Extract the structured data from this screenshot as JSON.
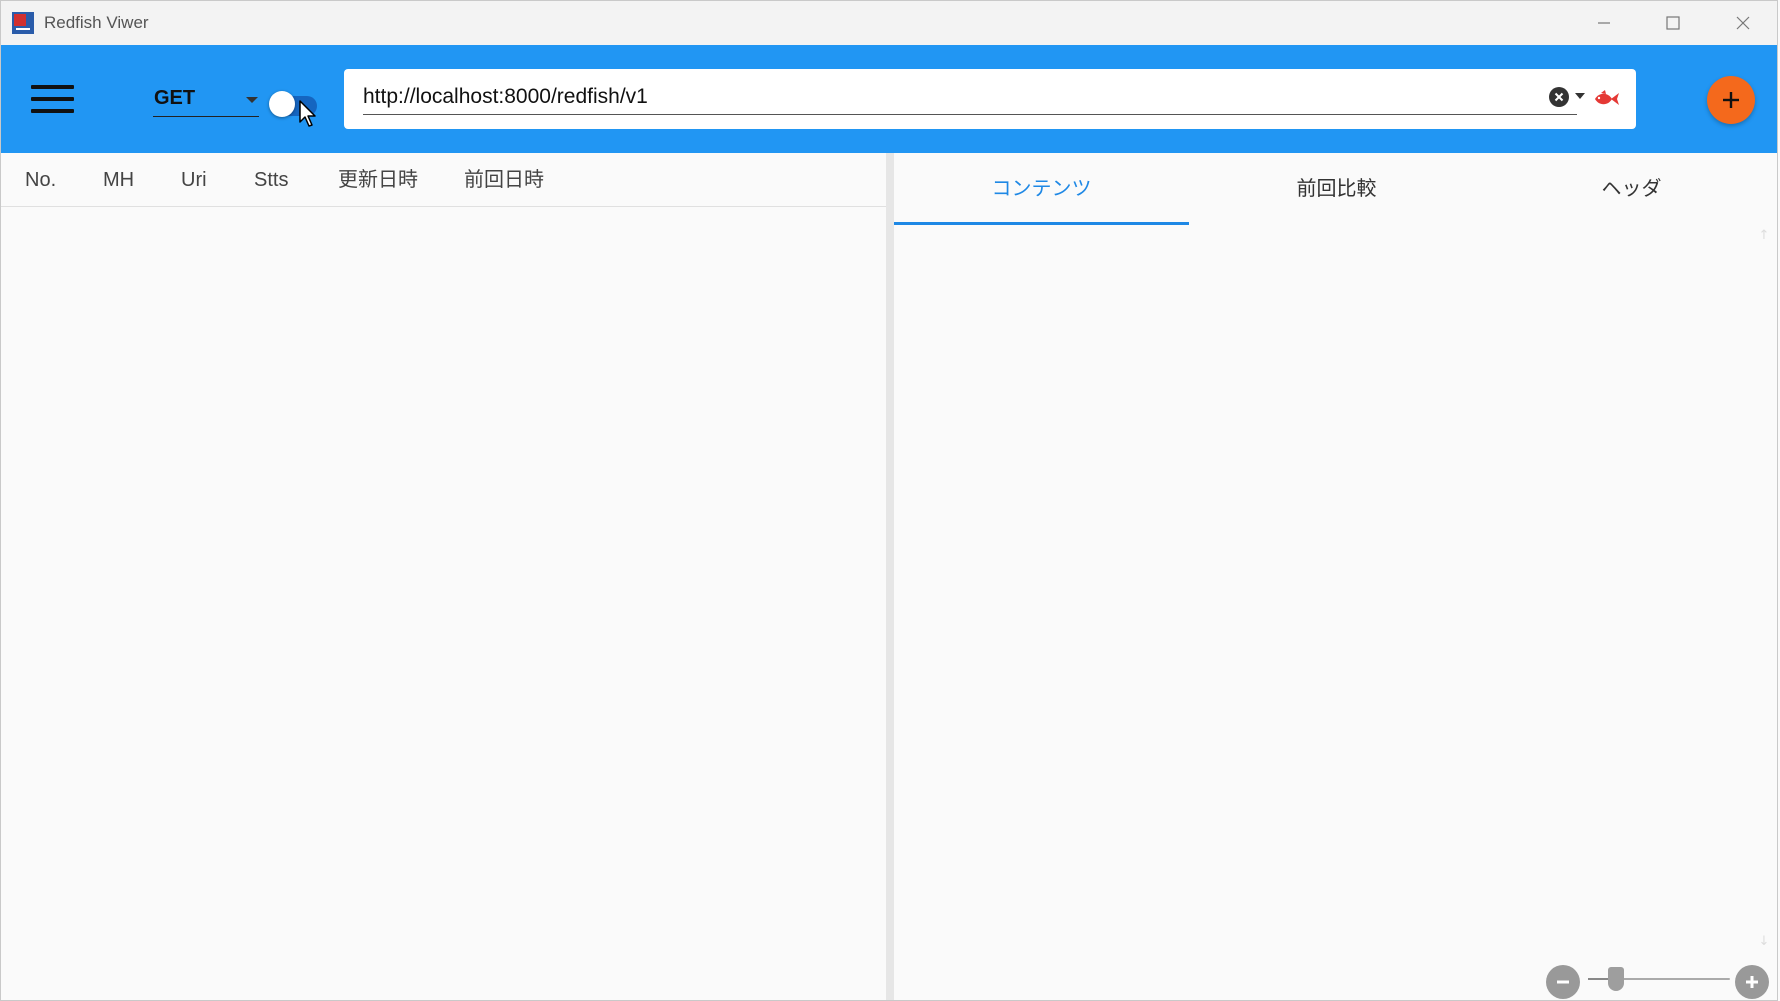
{
  "window": {
    "title": "Redfish Viwer"
  },
  "toolbar": {
    "method": "GET",
    "method_options_visible": [
      "GET"
    ],
    "toggle_on": true,
    "url": "http://localhost:8000/redfish/v1",
    "brand_color": "#2196f3",
    "fab_color": "#f4691c",
    "fish_color": "#e53935"
  },
  "left_pane": {
    "columns": [
      "No.",
      "MH",
      "Uri",
      "Stts",
      "更新日時",
      "前回日時"
    ],
    "rows": []
  },
  "right_pane": {
    "tabs": [
      "コンテンツ",
      "前回比較",
      "ヘッダ"
    ],
    "active_tab": 0,
    "accent_color": "#1e88e5"
  },
  "zoom": {
    "level": 0.2
  }
}
